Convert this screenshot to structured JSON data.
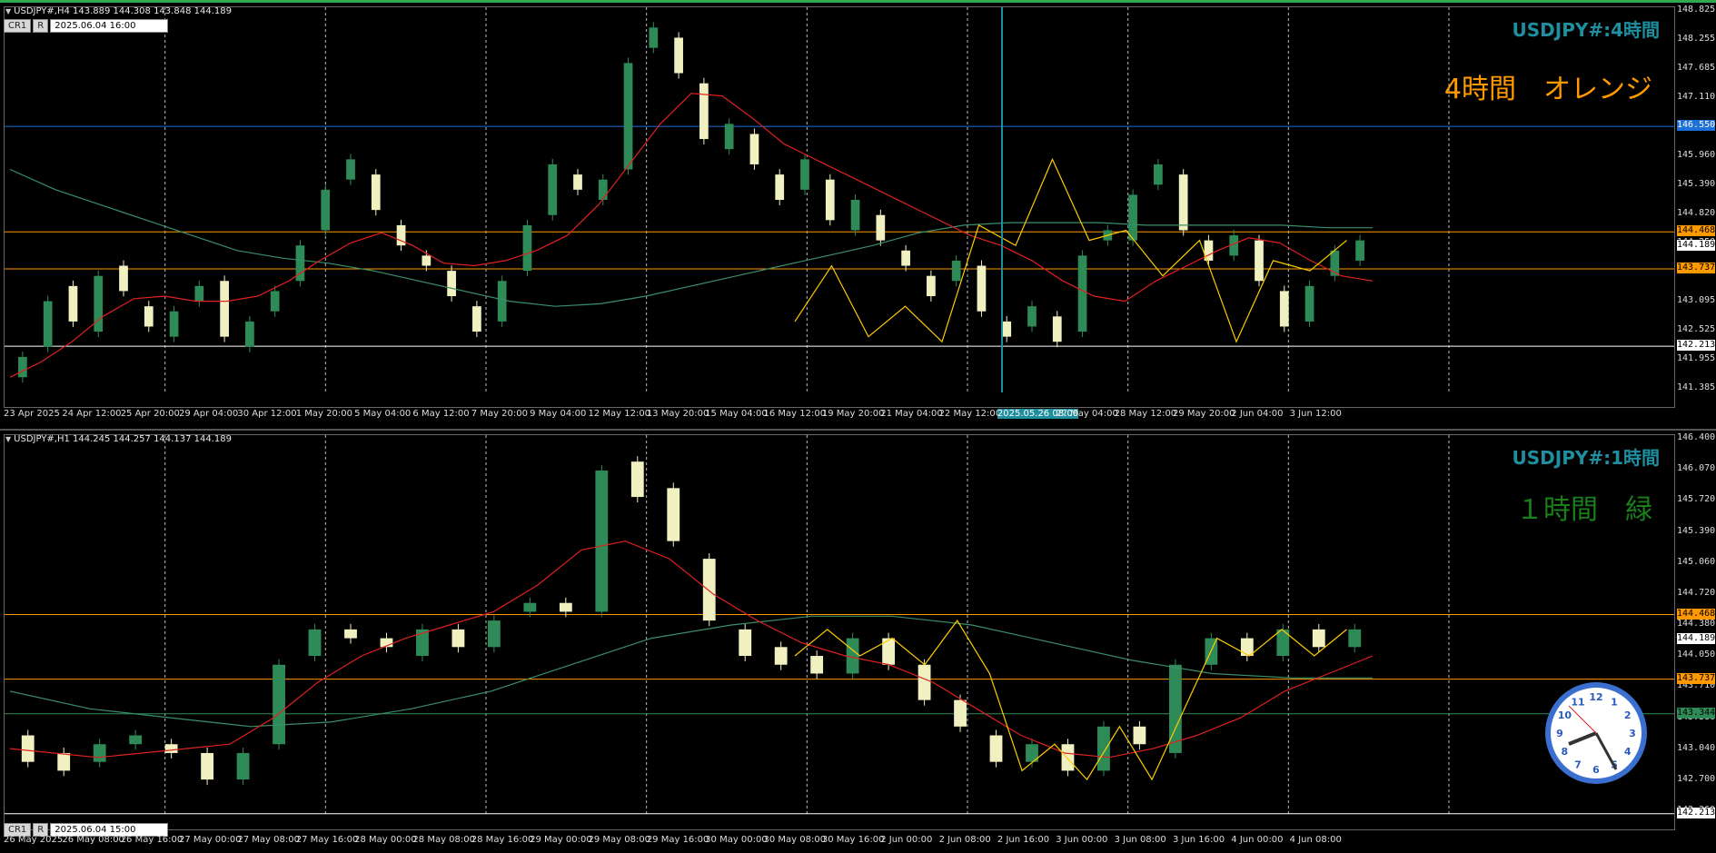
{
  "colors": {
    "orange": "#ff9900",
    "blue": "#1e6fd6",
    "white": "#ffffff",
    "green": "#2e8b57",
    "red": "#e02020",
    "cyan": "#1f8fa0",
    "bull": "#2e8b57",
    "bear": "#f0f0c0"
  },
  "chart_data": [
    {
      "type": "candlestick",
      "info": "USDJPY#,H4  143.889 144.308 143.848 144.189",
      "cr": [
        "CR1",
        "R"
      ],
      "datetime": "2025.06.04 16:00",
      "symbol_title": "USDJPY#:4時間",
      "big_title": "4時間　オレンジ",
      "big_title_color": "#ff9900",
      "ylim": [
        141.3,
        148.9
      ],
      "price_labels": [
        "148.825",
        "148.255",
        "147.685",
        "147.110",
        "146.540",
        "145.960",
        "145.390",
        "144.820",
        "144.250",
        "143.665",
        "143.095",
        "142.525",
        "141.955",
        "141.385"
      ],
      "badges": [
        {
          "value": "146.550",
          "level": 146.55,
          "bg": "#1e6fd6",
          "fg": "#ffffff",
          "line": "#1e6fd6"
        },
        {
          "value": "144.468",
          "level": 144.468,
          "bg": "#ff9900",
          "fg": "#000000",
          "line": "#ff9900"
        },
        {
          "value": "144.189",
          "level": 144.189,
          "bg": "#ffffff",
          "fg": "#000000",
          "line": null
        },
        {
          "value": "143.737",
          "level": 143.737,
          "bg": "#ff9900",
          "fg": "#000000",
          "line": "#ff9900"
        },
        {
          "value": "142.213",
          "level": 142.213,
          "bg": "#ffffff",
          "fg": "#000000",
          "line": "#ffffff"
        }
      ],
      "time_labels": [
        "23 Apr 2025",
        "24 Apr 12:00",
        "25 Apr 20:00",
        "29 Apr 04:00",
        "30 Apr 12:00",
        "1 May 20:00",
        "5 May 04:00",
        "6 May 12:00",
        "7 May 20:00",
        "9 May 04:00",
        "12 May 12:00",
        "13 May 20:00",
        "15 May 04:00",
        "16 May 12:00",
        "19 May 20:00",
        "21 May 04:00",
        "22 May 12:00",
        "2025.05.26 08:00",
        "27 May 04:00",
        "28 May 12:00",
        "29 May 20:00",
        "2 Jun 04:00",
        "3 Jun 12:00"
      ],
      "ma_red": [
        141.6,
        141.9,
        142.3,
        142.8,
        143.15,
        143.2,
        143.1,
        143.1,
        143.2,
        143.5,
        143.9,
        144.25,
        144.45,
        144.2,
        143.85,
        143.8,
        143.9,
        144.1,
        144.4,
        145.0,
        145.8,
        146.6,
        147.2,
        147.15,
        146.7,
        146.2,
        145.9,
        145.6,
        145.3,
        145.0,
        144.7,
        144.4,
        144.2,
        143.9,
        143.5,
        143.2,
        143.1,
        143.5,
        143.8,
        144.1,
        144.35,
        144.25,
        143.9,
        143.6,
        143.5
      ],
      "ma_green": [
        145.7,
        145.3,
        145.0,
        144.7,
        144.4,
        144.1,
        143.95,
        143.85,
        143.7,
        143.5,
        143.3,
        143.1,
        143.0,
        143.05,
        143.2,
        143.4,
        143.6,
        143.8,
        144.0,
        144.2,
        144.45,
        144.6,
        144.65,
        144.65,
        144.65,
        144.6,
        144.6,
        144.6,
        144.6,
        144.55,
        144.55
      ],
      "zigzag": [
        142.7,
        143.8,
        142.4,
        143.0,
        142.3,
        144.6,
        144.2,
        145.9,
        144.3,
        144.5,
        143.6,
        144.3,
        142.3,
        143.9,
        143.7,
        144.3
      ],
      "candles": [
        [
          141.6,
          142.0
        ],
        [
          142.2,
          143.1
        ],
        [
          143.4,
          142.7
        ],
        [
          142.5,
          143.6
        ],
        [
          143.8,
          143.3
        ],
        [
          143.0,
          142.6
        ],
        [
          142.4,
          142.9
        ],
        [
          143.1,
          143.4
        ],
        [
          143.5,
          142.4
        ],
        [
          142.2,
          142.7
        ],
        [
          142.9,
          143.3
        ],
        [
          143.5,
          144.2
        ],
        [
          144.5,
          145.3
        ],
        [
          145.5,
          145.9
        ],
        [
          145.6,
          144.9
        ],
        [
          144.6,
          144.2
        ],
        [
          144.0,
          143.8
        ],
        [
          143.7,
          143.2
        ],
        [
          143.0,
          142.5
        ],
        [
          142.7,
          143.5
        ],
        [
          143.7,
          144.6
        ],
        [
          144.8,
          145.8
        ],
        [
          145.6,
          145.3
        ],
        [
          145.1,
          145.5
        ],
        [
          145.7,
          147.8
        ],
        [
          148.1,
          148.5
        ],
        [
          148.3,
          147.6
        ],
        [
          147.4,
          146.3
        ],
        [
          146.1,
          146.6
        ],
        [
          146.4,
          145.8
        ],
        [
          145.6,
          145.1
        ],
        [
          145.3,
          145.9
        ],
        [
          145.5,
          144.7
        ],
        [
          144.5,
          145.1
        ],
        [
          144.8,
          144.3
        ],
        [
          144.1,
          143.8
        ],
        [
          143.6,
          143.2
        ],
        [
          143.5,
          143.9
        ],
        [
          143.8,
          142.9
        ],
        [
          142.7,
          142.4
        ],
        [
          142.6,
          143.0
        ],
        [
          142.8,
          142.3
        ],
        [
          142.5,
          144.0
        ],
        [
          144.3,
          144.5
        ],
        [
          144.3,
          145.2
        ],
        [
          145.4,
          145.8
        ],
        [
          145.6,
          144.5
        ],
        [
          144.3,
          143.9
        ],
        [
          144.0,
          144.4
        ],
        [
          144.3,
          143.5
        ],
        [
          143.3,
          142.6
        ],
        [
          142.7,
          143.4
        ],
        [
          143.6,
          144.1
        ],
        [
          143.9,
          144.3
        ]
      ]
    },
    {
      "type": "candlestick",
      "info": "USDJPY#,H1  144.245 144.257 144.137 144.189",
      "cr": [
        "CR1",
        "R"
      ],
      "datetime": "2025.06.04 15:00",
      "symbol_title": "USDJPY#:1時間",
      "big_title": "１時間　緑",
      "big_title_color": "#1a7f1a",
      "ylim": [
        142.2,
        146.5
      ],
      "price_labels": [
        "146.400",
        "146.070",
        "145.720",
        "145.390",
        "145.060",
        "144.720",
        "144.380",
        "144.050",
        "143.710",
        "143.380",
        "143.040",
        "142.700",
        "142.360"
      ],
      "badges": [
        {
          "value": "144.468",
          "level": 144.468,
          "bg": "#ff9900",
          "fg": "#000000",
          "line": "#ff9900"
        },
        {
          "value": "144.189",
          "level": 144.189,
          "bg": "#ffffff",
          "fg": "#000000",
          "line": null
        },
        {
          "value": "143.737",
          "level": 143.737,
          "bg": "#ff9900",
          "fg": "#000000",
          "line": "#ff9900"
        },
        {
          "value": "143.344",
          "level": 143.344,
          "bg": "#2e8b57",
          "fg": "#000000",
          "line": "#2e8b57"
        },
        {
          "value": "142.213",
          "level": 142.213,
          "bg": "#ffffff",
          "fg": "#000000",
          "line": "#ffffff"
        }
      ],
      "time_labels": [
        "26 May 2025",
        "26 May 08:00",
        "26 May 16:00",
        "27 May 00:00",
        "27 May 08:00",
        "27 May 16:00",
        "28 May 00:00",
        "28 May 08:00",
        "28 May 16:00",
        "29 May 00:00",
        "29 May 08:00",
        "29 May 16:00",
        "30 May 00:00",
        "30 May 08:00",
        "30 May 16:00",
        "2 Jun 00:00",
        "2 Jun 08:00",
        "2 Jun 16:00",
        "3 Jun 00:00",
        "3 Jun 08:00",
        "3 Jun 16:00",
        "4 Jun 00:00",
        "4 Jun 08:00"
      ],
      "ma_red": [
        142.95,
        142.9,
        142.85,
        142.9,
        142.95,
        143.0,
        143.3,
        143.7,
        144.0,
        144.2,
        144.35,
        144.5,
        144.8,
        145.2,
        145.3,
        145.1,
        144.7,
        144.4,
        144.15,
        144.0,
        143.9,
        143.7,
        143.4,
        143.1,
        142.9,
        142.85,
        142.95,
        143.1,
        143.3,
        143.6,
        143.8,
        144.0
      ],
      "ma_green": [
        143.6,
        143.4,
        143.3,
        143.2,
        143.25,
        143.4,
        143.6,
        143.9,
        144.2,
        144.35,
        144.45,
        144.45,
        144.35,
        144.15,
        143.95,
        143.8,
        143.75,
        143.75
      ],
      "zigzag": [
        144.0,
        144.3,
        144.0,
        144.2,
        143.9,
        144.4,
        143.8,
        142.7,
        143.0,
        142.6,
        143.2,
        142.6,
        143.4,
        144.2,
        144.0,
        144.3,
        144.0,
        144.3
      ],
      "candles": [
        [
          143.1,
          142.8
        ],
        [
          142.9,
          142.7
        ],
        [
          142.8,
          143.0
        ],
        [
          143.0,
          143.1
        ],
        [
          143.0,
          142.9
        ],
        [
          142.9,
          142.6
        ],
        [
          142.6,
          142.9
        ],
        [
          143.0,
          143.9
        ],
        [
          144.0,
          144.3
        ],
        [
          144.3,
          144.2
        ],
        [
          144.2,
          144.1
        ],
        [
          144.0,
          144.3
        ],
        [
          144.3,
          144.1
        ],
        [
          144.1,
          144.4
        ],
        [
          144.5,
          144.6
        ],
        [
          144.6,
          144.5
        ],
        [
          144.5,
          146.1
        ],
        [
          146.2,
          145.8
        ],
        [
          145.9,
          145.3
        ],
        [
          145.1,
          144.4
        ],
        [
          144.3,
          144.0
        ],
        [
          144.1,
          143.9
        ],
        [
          144.0,
          143.8
        ],
        [
          143.8,
          144.2
        ],
        [
          144.2,
          143.9
        ],
        [
          143.9,
          143.5
        ],
        [
          143.5,
          143.2
        ],
        [
          143.1,
          142.8
        ],
        [
          142.8,
          143.0
        ],
        [
          143.0,
          142.7
        ],
        [
          142.7,
          143.2
        ],
        [
          143.2,
          143.0
        ],
        [
          142.9,
          143.9
        ],
        [
          143.9,
          144.2
        ],
        [
          144.2,
          144.0
        ],
        [
          144.0,
          144.3
        ],
        [
          144.3,
          144.1
        ],
        [
          144.1,
          144.3
        ]
      ]
    }
  ]
}
